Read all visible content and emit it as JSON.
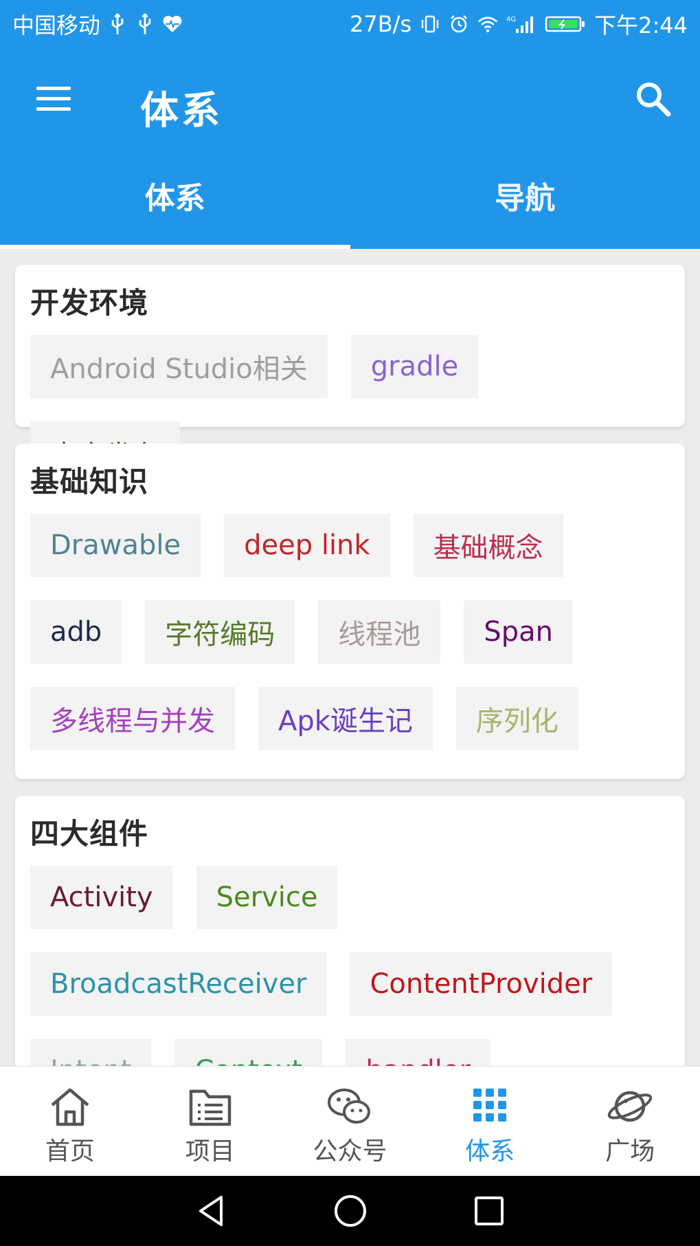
{
  "status_bar": {
    "carrier": "中国移动",
    "speed": "27B/s",
    "time": "下午2:44",
    "network_badge": "4G"
  },
  "toolbar": {
    "title": "体系"
  },
  "tabs": [
    {
      "label": "体系",
      "active": true
    },
    {
      "label": "导航",
      "active": false
    }
  ],
  "cards": [
    {
      "title": "开发环境",
      "chips": [
        {
          "label": "Android Studio相关",
          "color": "#9e9e9e"
        },
        {
          "label": "gradle",
          "color": "#8a63c9"
        },
        {
          "label": "官方发布",
          "color": "#4a4a1a"
        }
      ]
    },
    {
      "title": "基础知识",
      "chips": [
        {
          "label": "Drawable",
          "color": "#4f8393"
        },
        {
          "label": "deep link",
          "color": "#c0262b"
        },
        {
          "label": "基础概念",
          "color": "#b8304e"
        },
        {
          "label": "adb",
          "color": "#1d2a4a"
        },
        {
          "label": "字符编码",
          "color": "#567a2a"
        },
        {
          "label": "线程池",
          "color": "#a89a9a"
        },
        {
          "label": "Span",
          "color": "#6a0a6a"
        },
        {
          "label": "多线程与并发",
          "color": "#a53fbd"
        },
        {
          "label": "Apk诞生记",
          "color": "#6a3fbf"
        },
        {
          "label": "序列化",
          "color": "#a3b56a"
        }
      ]
    },
    {
      "title": "四大组件",
      "chips": [
        {
          "label": "Activity",
          "color": "#6a1a35"
        },
        {
          "label": "Service",
          "color": "#4b8a1f"
        },
        {
          "label": "BroadcastReceiver",
          "color": "#2a93a8"
        },
        {
          "label": "ContentProvider",
          "color": "#c0161c"
        },
        {
          "label": "Intent",
          "color": "#8fa89a"
        },
        {
          "label": "Context",
          "color": "#3a9a50"
        },
        {
          "label": "handler",
          "color": "#c0265a"
        }
      ]
    }
  ],
  "bottom_nav": [
    {
      "label": "首页",
      "icon": "home-icon",
      "active": false
    },
    {
      "label": "项目",
      "icon": "project-icon",
      "active": false
    },
    {
      "label": "公众号",
      "icon": "wechat-icon",
      "active": false
    },
    {
      "label": "体系",
      "icon": "grid-icon",
      "active": true
    },
    {
      "label": "广场",
      "icon": "planet-icon",
      "active": false
    }
  ],
  "colors": {
    "primary": "#2196e9",
    "active_nav": "#2196e9",
    "inactive_nav": "#555555"
  }
}
